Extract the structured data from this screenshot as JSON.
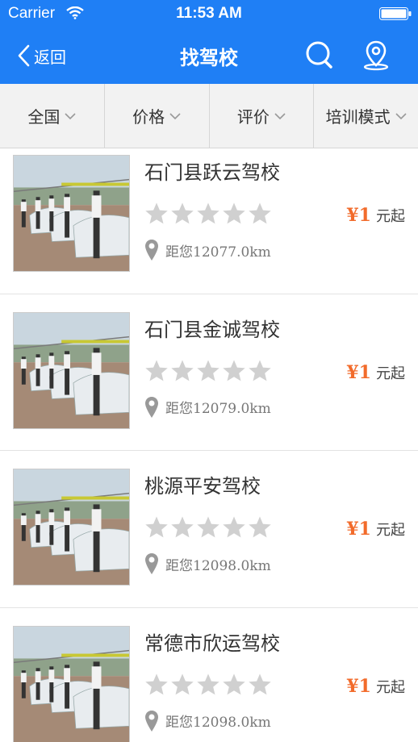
{
  "status_bar": {
    "carrier": "Carrier",
    "time": "11:53 AM"
  },
  "nav": {
    "back_label": "返回",
    "title": "找驾校"
  },
  "filters": [
    {
      "label": "全国"
    },
    {
      "label": "价格"
    },
    {
      "label": "评价"
    },
    {
      "label": "培训模式"
    }
  ],
  "schools": [
    {
      "name": "石门县跃云驾校",
      "rating": 0,
      "price": "¥1",
      "price_suffix": "元起",
      "distance": "距您12077.0km"
    },
    {
      "name": "石门县金诚驾校",
      "rating": 0,
      "price": "¥1",
      "price_suffix": "元起",
      "distance": "距您12079.0km"
    },
    {
      "name": "桃源平安驾校",
      "rating": 0,
      "price": "¥1",
      "price_suffix": "元起",
      "distance": "距您12098.0km"
    },
    {
      "name": "常德市欣运驾校",
      "rating": 0,
      "price": "¥1",
      "price_suffix": "元起",
      "distance": "距您12098.0km"
    }
  ],
  "colors": {
    "brand": "#1f7ff5",
    "price": "#f26b2b",
    "star_empty": "#d0d0d0"
  }
}
